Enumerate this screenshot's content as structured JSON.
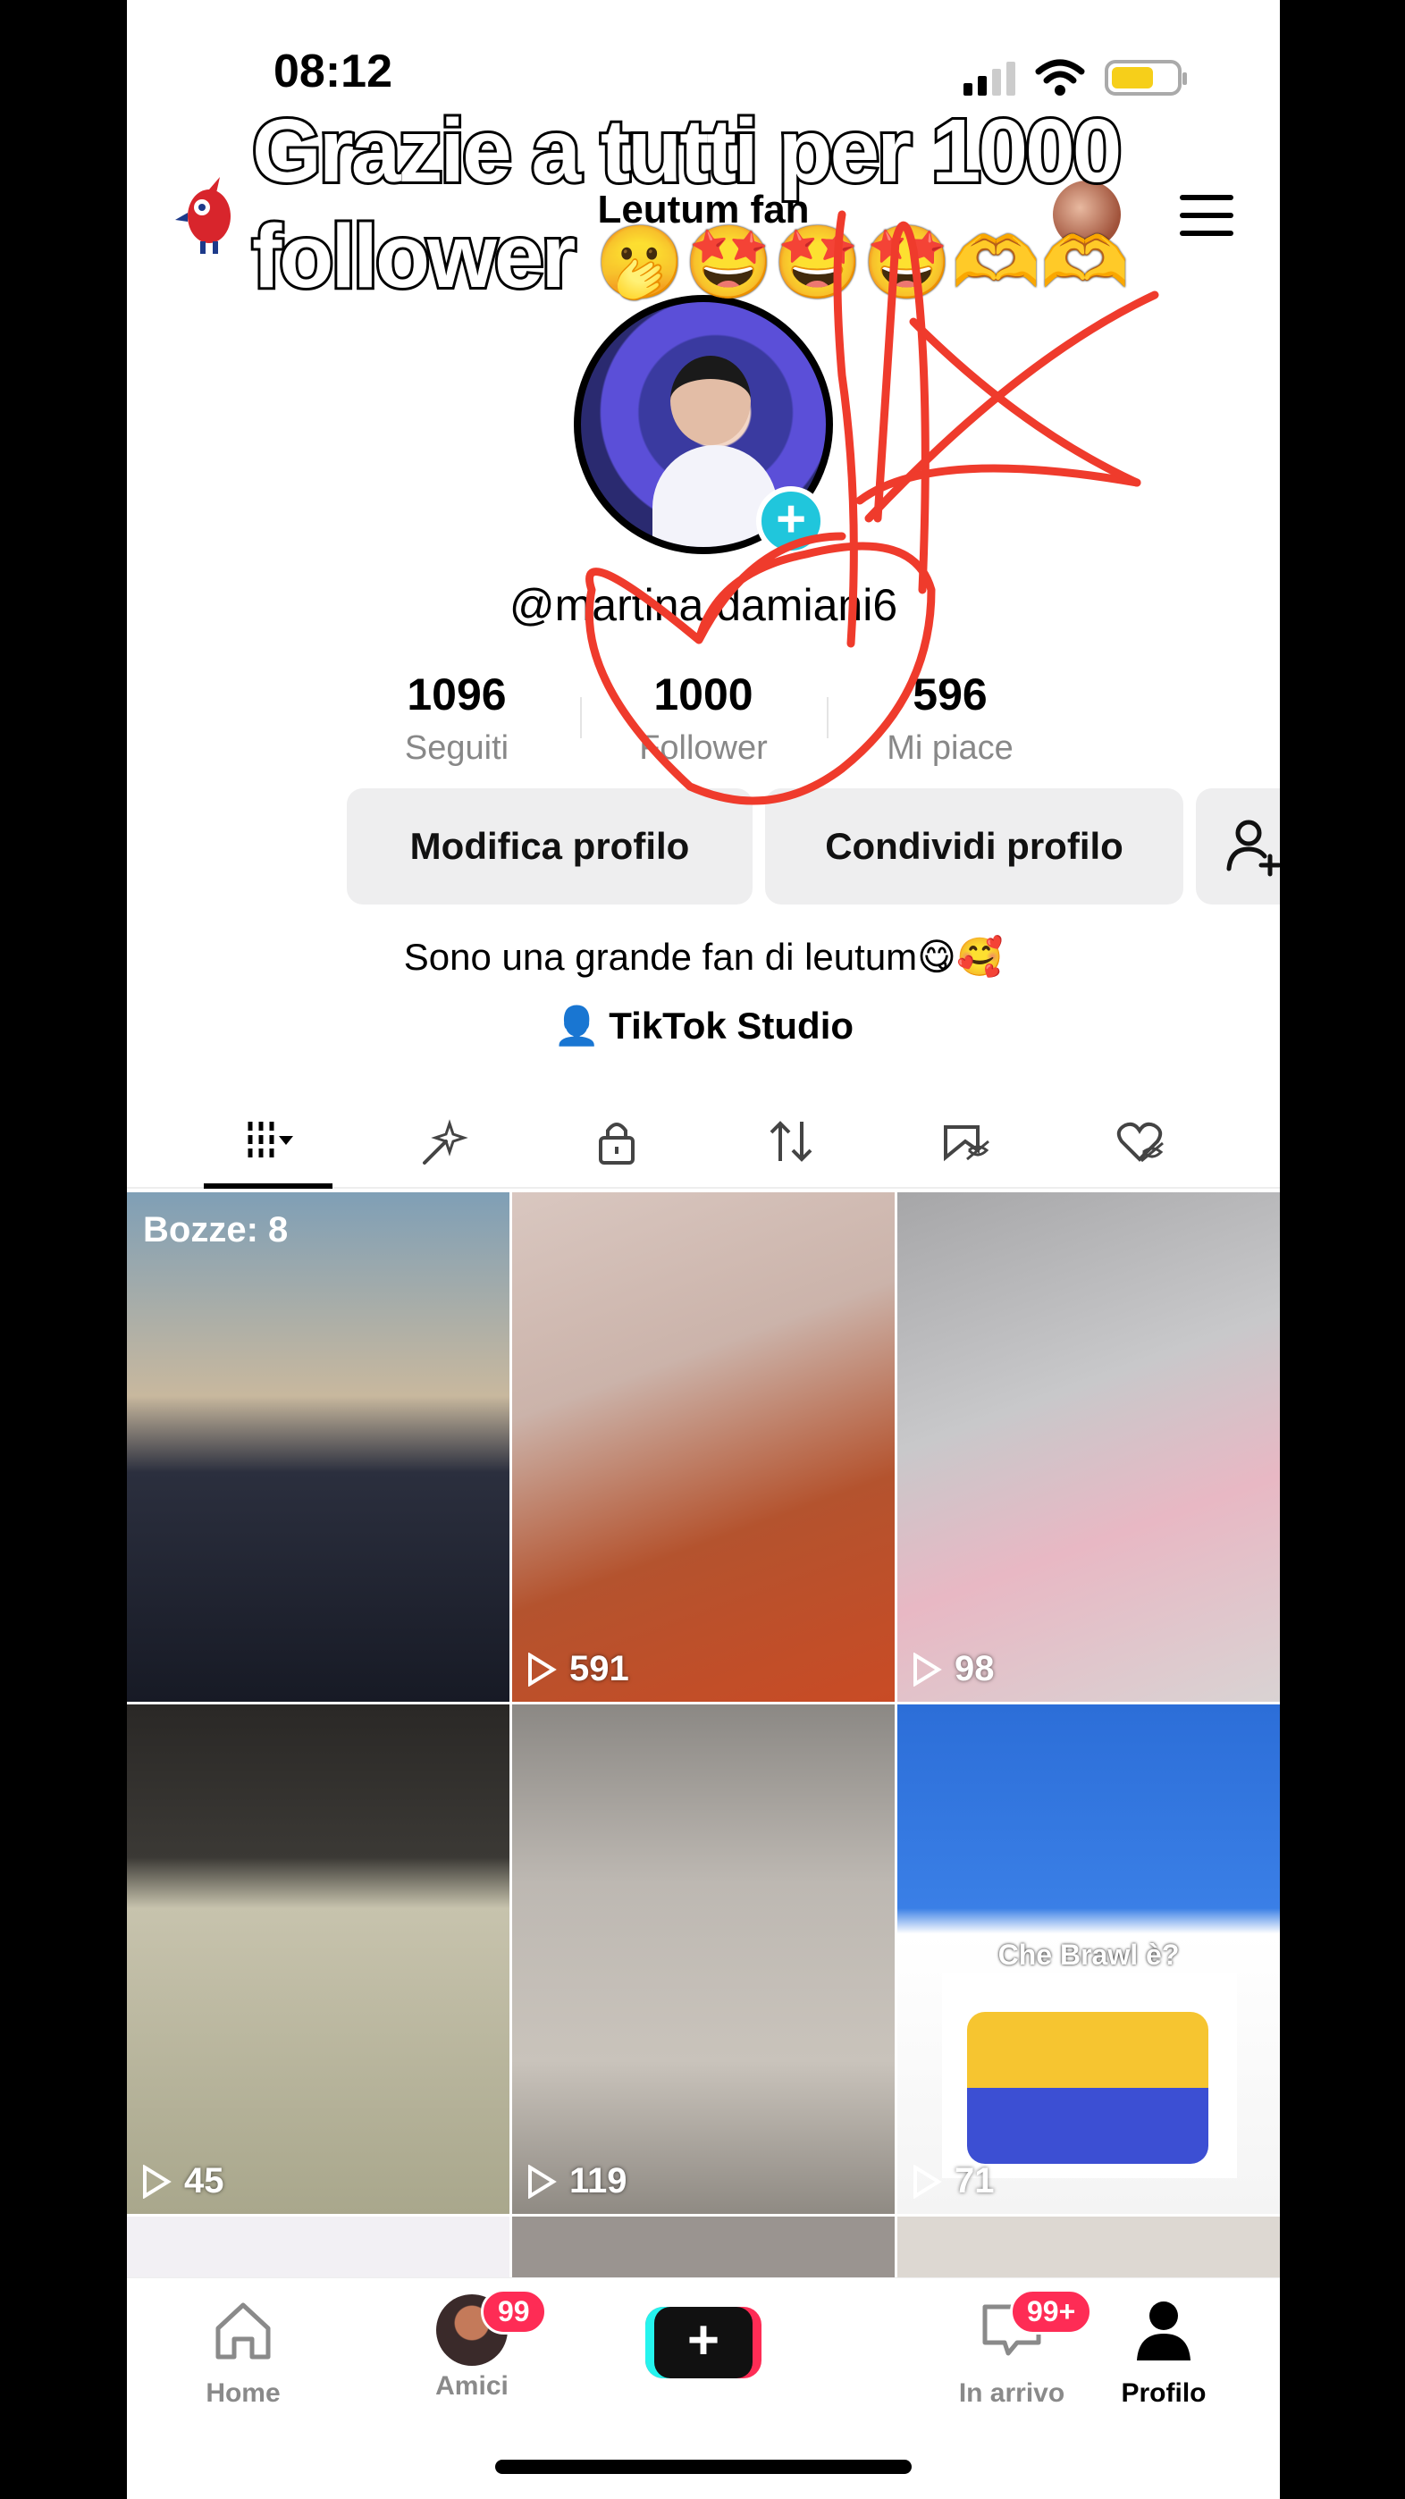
{
  "status_bar": {
    "time": "08:12"
  },
  "overlay_caption": "Grazie a tutti per 1000 follower",
  "overlay_emojis": "🫢🤩🤩🤩🫶🫶",
  "header": {
    "title": "Leutum fan"
  },
  "profile": {
    "username": "@martina.damiani6",
    "stats": [
      {
        "value": "1096",
        "label": "Seguiti"
      },
      {
        "value": "1000",
        "label": "Follower"
      },
      {
        "value": "596",
        "label": "Mi piace"
      }
    ],
    "edit_label": "Modifica profilo",
    "share_label": "Condividi profilo",
    "bio": "Sono una grande fan di leutum😋🥰",
    "studio_label": "TikTok Studio"
  },
  "tabs": [
    "videos-grid",
    "favorites-sparkle",
    "private-lock",
    "reposts",
    "saved",
    "liked"
  ],
  "grid": {
    "drafts_label": "Bozze: 8",
    "cells": [
      {
        "views": ""
      },
      {
        "views": "591"
      },
      {
        "views": "98"
      },
      {
        "views": "45"
      },
      {
        "views": "119"
      },
      {
        "views": "71",
        "caption": "Che Brawl è?"
      }
    ]
  },
  "bottom_nav": {
    "home": "Home",
    "friends": "Amici",
    "friends_badge": "99",
    "inbox": "In arrivo",
    "inbox_badge": "99+",
    "profile": "Profilo"
  },
  "colors": {
    "accent": "#fe2c55",
    "cyan": "#25f4ee",
    "scribble": "#ef3b2c"
  }
}
